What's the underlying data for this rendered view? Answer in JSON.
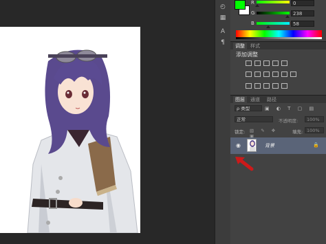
{
  "color_panel": {
    "foreground": "#00ff00",
    "background": "#ffffff",
    "sliders": [
      {
        "label": "R",
        "value": "0",
        "track": "linear-gradient(to right,#00ff00,#ffff00)"
      },
      {
        "label": "G",
        "value": "238",
        "track": "linear-gradient(to right,#000000,#00ff00)"
      },
      {
        "label": "B",
        "value": "58",
        "track": "linear-gradient(to right,#00ee00,#00eeff)"
      }
    ]
  },
  "adjustments": {
    "tabs": [
      "调整",
      "样式"
    ],
    "title": "添加调整"
  },
  "layers": {
    "tabs": [
      "图层",
      "通道",
      "路径"
    ],
    "filter_label": "ρ 类型",
    "blend_mode": "正常",
    "opacity_label": "不透明度:",
    "opacity_value": "100%",
    "lock_label": "锁定:",
    "fill_label": "填充:",
    "fill_value": "100%",
    "items": [
      {
        "name": "背景"
      }
    ]
  },
  "tools": [
    {
      "icon": "3d-rotate-icon",
      "glyph": "◴"
    },
    {
      "icon": "brush-settings-icon",
      "glyph": "▦"
    },
    {
      "icon": "character-icon",
      "glyph": "A"
    },
    {
      "icon": "paragraph-icon",
      "glyph": "¶"
    }
  ],
  "colors": {
    "annotation_arrow": "#cc1a1a",
    "selected_layer": "#5a6478"
  }
}
